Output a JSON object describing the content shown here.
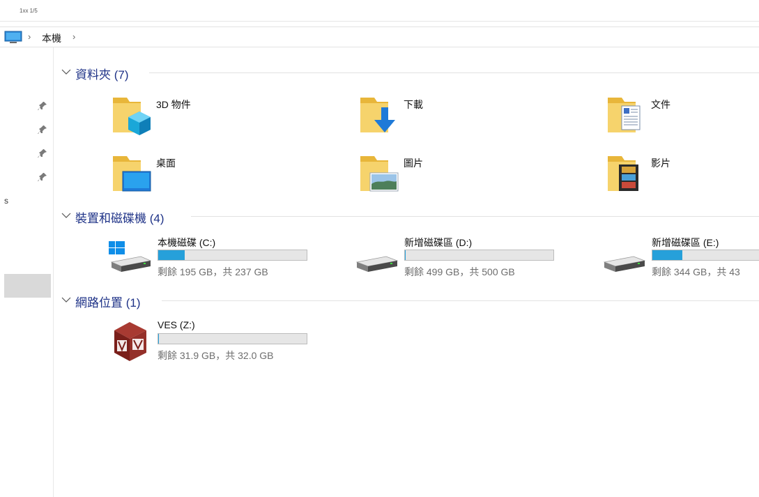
{
  "window": {
    "title_fragment": "1xx 1/5"
  },
  "address": {
    "location": "本機"
  },
  "navpane": {
    "partial_label": "s"
  },
  "groups": {
    "folders": {
      "title": "資料夾 (7)"
    },
    "drives": {
      "title": "裝置和磁碟機 (4)"
    },
    "network": {
      "title": "網路位置 (1)"
    }
  },
  "folders": [
    {
      "label": "3D 物件",
      "icon": "3d-objects-folder-icon"
    },
    {
      "label": "下載",
      "icon": "downloads-folder-icon"
    },
    {
      "label": "文件",
      "icon": "documents-folder-icon"
    },
    {
      "label": "桌面",
      "icon": "desktop-folder-icon"
    },
    {
      "label": "圖片",
      "icon": "pictures-folder-icon"
    },
    {
      "label": "影片",
      "icon": "videos-folder-icon"
    }
  ],
  "drives": [
    {
      "name": "本機磁碟 (C:)",
      "space": "剩餘 195 GB，共 237 GB",
      "used_fraction": 0.177,
      "icon": "windows-drive-icon"
    },
    {
      "name": "新增磁碟區 (D:)",
      "space": "剩餘 499 GB，共 500 GB",
      "used_fraction": 0.002,
      "icon": "hard-drive-icon"
    },
    {
      "name": "新增磁碟區 (E:)",
      "space": "剩餘 344 GB，共 43",
      "used_fraction": 0.2,
      "icon": "hard-drive-icon"
    }
  ],
  "network": [
    {
      "name": "VES (Z:)",
      "space": "剩餘 31.9 GB，共 32.0 GB",
      "used_fraction": 0.003,
      "icon": "virtualbox-share-icon"
    }
  ],
  "colors": {
    "accent_bar": "#26a0da",
    "group_title": "#1e3287"
  }
}
